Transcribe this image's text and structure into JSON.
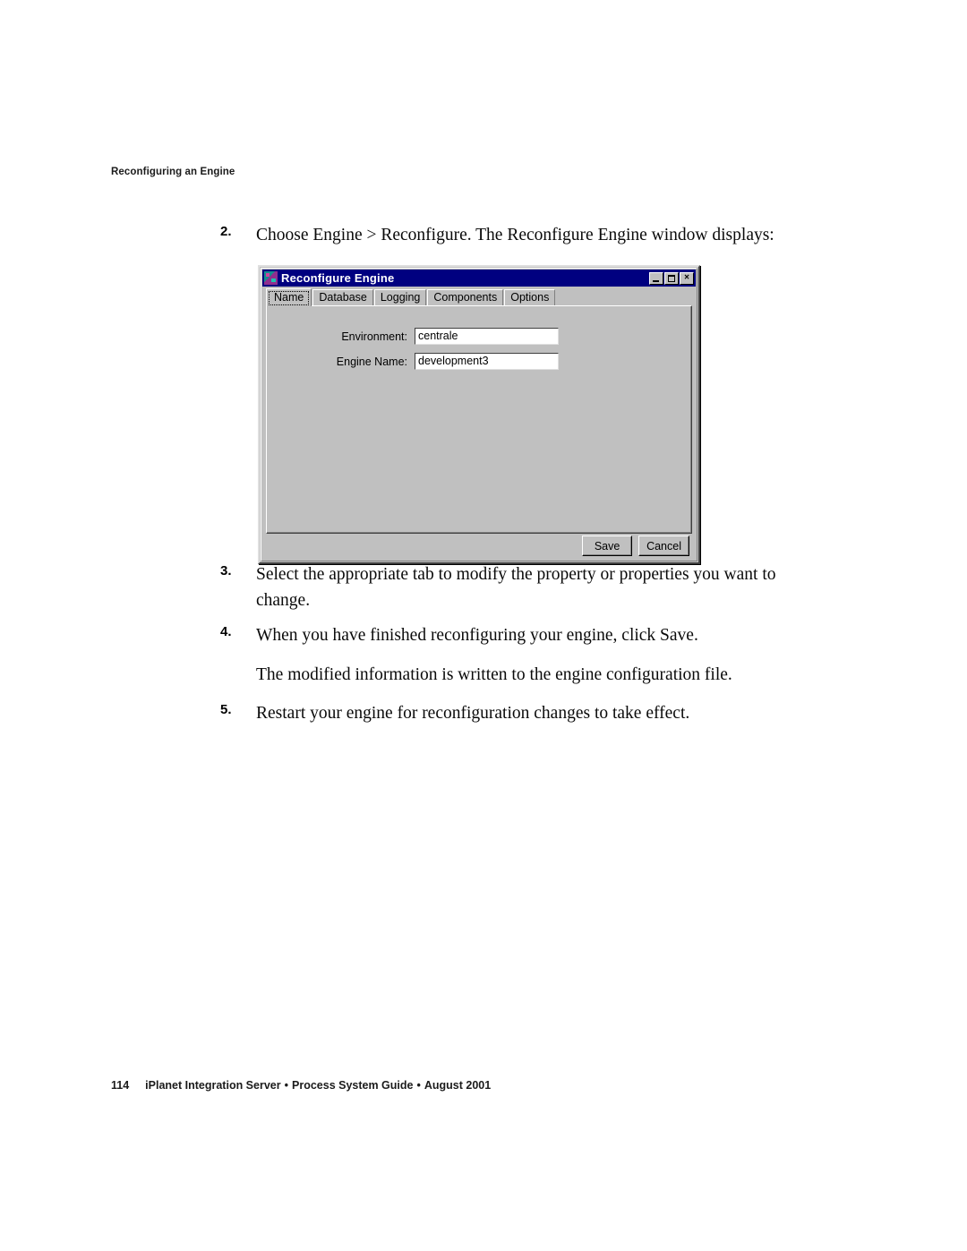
{
  "page": {
    "running_head": "Reconfiguring an Engine",
    "page_number": "114",
    "footer_book": "iPlanet Integration Server",
    "footer_sep1": "•",
    "footer_guide": "Process System Guide",
    "footer_sep2": "•",
    "footer_date": "August 2001"
  },
  "steps": {
    "step2_num": "2.",
    "step2_text": "Choose Engine > Reconfigure. The Reconfigure Engine window displays:",
    "step3_num": "3.",
    "step3_text": "Select the appropriate tab to modify the property or properties you want to change.",
    "step4_num": "4.",
    "step4_text": "When you have finished reconfiguring your engine, click Save.",
    "step4_note": "The modified information is written to the engine configuration file.",
    "step5_num": "5.",
    "step5_text": "Restart your engine for reconfiguration changes to take effect."
  },
  "dialog": {
    "title": "Reconfigure Engine",
    "icon": "app-icon",
    "window_controls": {
      "minimize": "minimize-icon",
      "maximize": "maximize-icon",
      "close": "×"
    },
    "tabs": [
      {
        "label": "Name",
        "selected": true
      },
      {
        "label": "Database",
        "selected": false
      },
      {
        "label": "Logging",
        "selected": false
      },
      {
        "label": "Components",
        "selected": false
      },
      {
        "label": "Options",
        "selected": false
      }
    ],
    "fields": [
      {
        "label": "Environment:",
        "value": "centrale",
        "placeholder": ""
      },
      {
        "label": "Engine Name:",
        "value": "development3",
        "placeholder": ""
      }
    ],
    "buttons": [
      {
        "label": "Save"
      },
      {
        "label": "Cancel"
      }
    ],
    "colors": {
      "titlebar": "#000080",
      "face": "#c0c0c0",
      "shadow": "#808080",
      "dark_shadow": "#404040",
      "highlight": "#ffffff",
      "field_bg": "#ffffff",
      "text": "#000000",
      "title_text": "#ffffff"
    }
  }
}
